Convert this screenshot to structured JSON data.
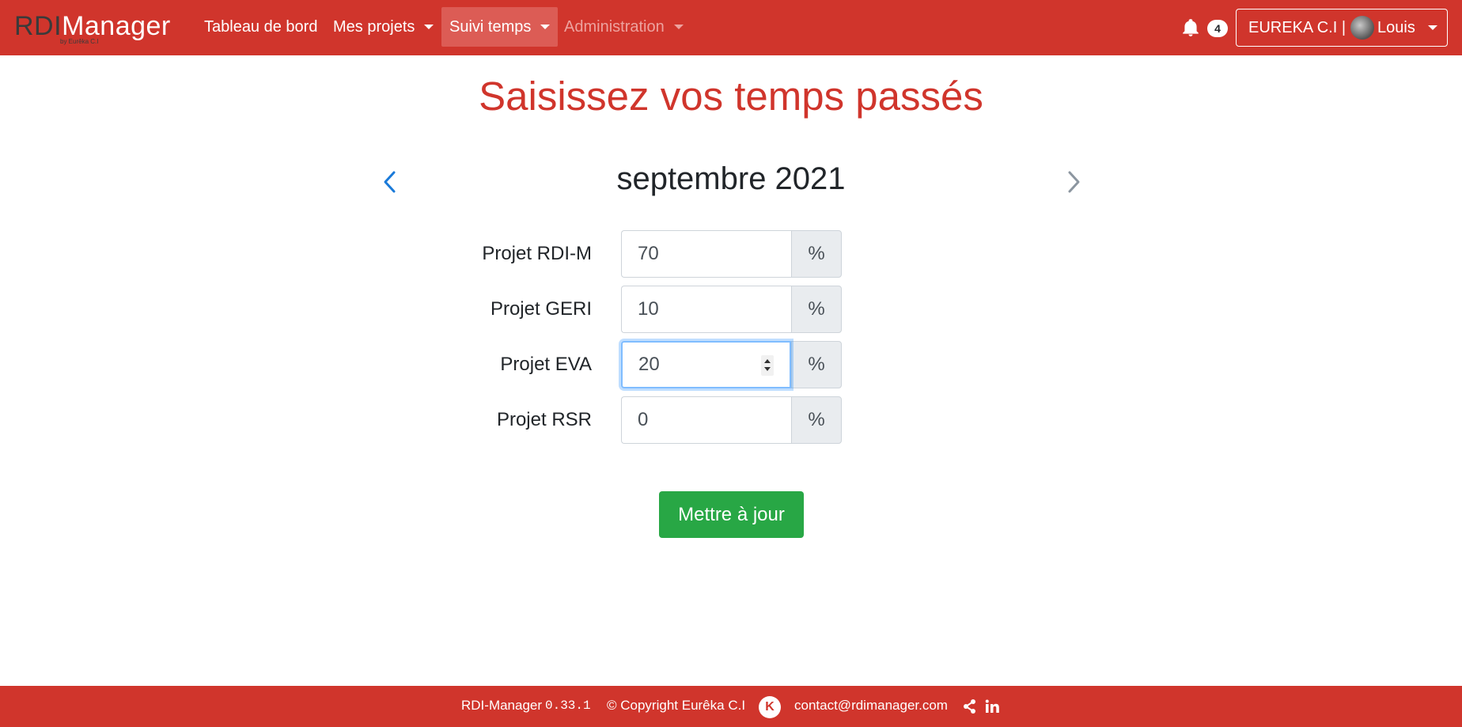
{
  "navbar": {
    "brand_rdi": "RDI",
    "brand_manager": "Manager",
    "brand_sub": "by Eurêka C.I",
    "items": [
      {
        "label": "Tableau de bord"
      },
      {
        "label": "Mes projets"
      },
      {
        "label": "Suivi temps"
      },
      {
        "label": "Administration"
      }
    ],
    "notifications_count": "4",
    "user_company": "EUREKA C.I |",
    "user_name": "Louis"
  },
  "main": {
    "title": "Saisissez vos temps passés",
    "month": "septembre 2021",
    "rows": [
      {
        "label": "Projet RDI-M",
        "value": "70",
        "unit": "%"
      },
      {
        "label": "Projet GERI",
        "value": "10",
        "unit": "%"
      },
      {
        "label": "Projet EVA",
        "value": "20",
        "unit": "%"
      },
      {
        "label": "Projet RSR",
        "value": "0",
        "unit": "%"
      }
    ],
    "submit_label": "Mettre à jour"
  },
  "footer": {
    "app_name": "RDI-Manager",
    "version": "0.33.1",
    "copyright": "© Copyright Eurêka C.I",
    "email": "contact@rdimanager.com"
  },
  "colors": {
    "primary_red": "#d0352c",
    "success_green": "#28a745",
    "focus_blue": "#80bdff",
    "prev_arrow": "#1a7ad9",
    "next_arrow": "#8c96a0"
  }
}
